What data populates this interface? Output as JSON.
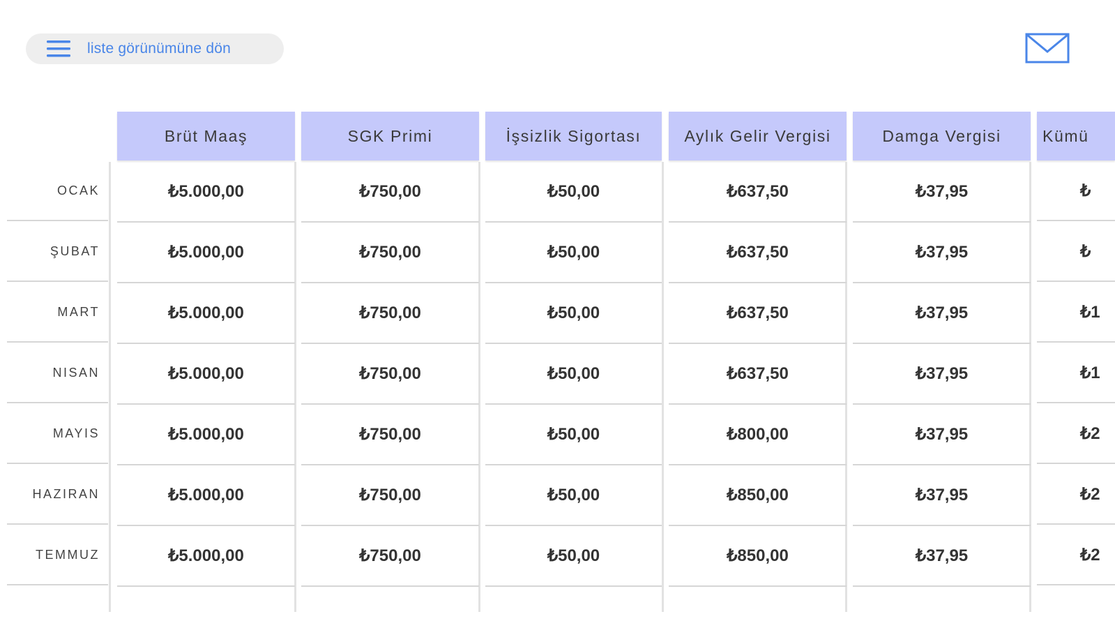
{
  "toolbar": {
    "back_label": "liste görünümüne dön",
    "menu_icon": "hamburger-menu-icon",
    "mail_icon": "mail-icon",
    "accent_color": "#4a86e8"
  },
  "table": {
    "header_color": "#c5c9fb",
    "headers": [
      "Brüt Maaş",
      "SGK Primi",
      "İşsizlik Sigortası",
      "Aylık Gelir Vergisi",
      "Damga Vergisi",
      "Kümü"
    ],
    "rows": [
      {
        "month": "OCAK",
        "values": [
          "₺5.000,00",
          "₺750,00",
          "₺50,00",
          "₺637,50",
          "₺37,95",
          "₺"
        ]
      },
      {
        "month": "ŞUBAT",
        "values": [
          "₺5.000,00",
          "₺750,00",
          "₺50,00",
          "₺637,50",
          "₺37,95",
          "₺"
        ]
      },
      {
        "month": "MART",
        "values": [
          "₺5.000,00",
          "₺750,00",
          "₺50,00",
          "₺637,50",
          "₺37,95",
          "₺1"
        ]
      },
      {
        "month": "NISAN",
        "values": [
          "₺5.000,00",
          "₺750,00",
          "₺50,00",
          "₺637,50",
          "₺37,95",
          "₺1"
        ]
      },
      {
        "month": "MAYIS",
        "values": [
          "₺5.000,00",
          "₺750,00",
          "₺50,00",
          "₺800,00",
          "₺37,95",
          "₺2"
        ]
      },
      {
        "month": "HAZIRAN",
        "values": [
          "₺5.000,00",
          "₺750,00",
          "₺50,00",
          "₺850,00",
          "₺37,95",
          "₺2"
        ]
      },
      {
        "month": "TEMMUZ",
        "values": [
          "₺5.000,00",
          "₺750,00",
          "₺50,00",
          "₺850,00",
          "₺37,95",
          "₺2"
        ]
      }
    ]
  }
}
